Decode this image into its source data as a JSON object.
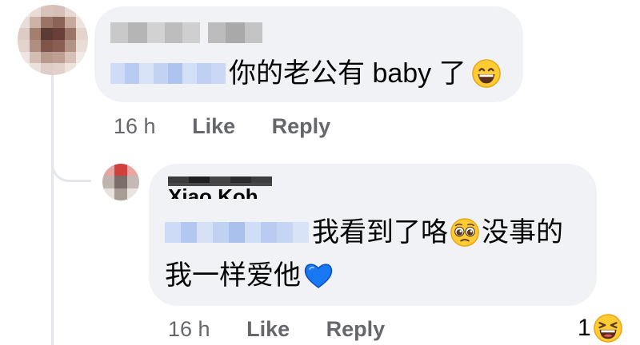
{
  "comment": {
    "author_name": "",
    "text": "你的老公有 baby 了",
    "emoji_name": "grinning-face-emoji",
    "time": "16 h",
    "like_label": "Like",
    "reply_label": "Reply"
  },
  "reply": {
    "author_name_partial": "Xiao Koh",
    "text_line1": "我看到了咯",
    "emoji1_name": "pleading-face-emoji",
    "text_line1_after": "没事的",
    "text_line2": "我一样爱他",
    "emoji2_name": "blue-heart-emoji",
    "time": "16 h",
    "like_label": "Like",
    "reply_label": "Reply",
    "reaction_count": "1",
    "reaction_icon": "laughing-face-emoji"
  },
  "colors": {
    "bubble_bg": "#f0f2f5",
    "meta_text": "#65676b",
    "body_text": "#050505",
    "thread_line": "#e4e6eb",
    "heart_blue": "#1877f2",
    "emoji_yellow": "#ffcc33"
  }
}
